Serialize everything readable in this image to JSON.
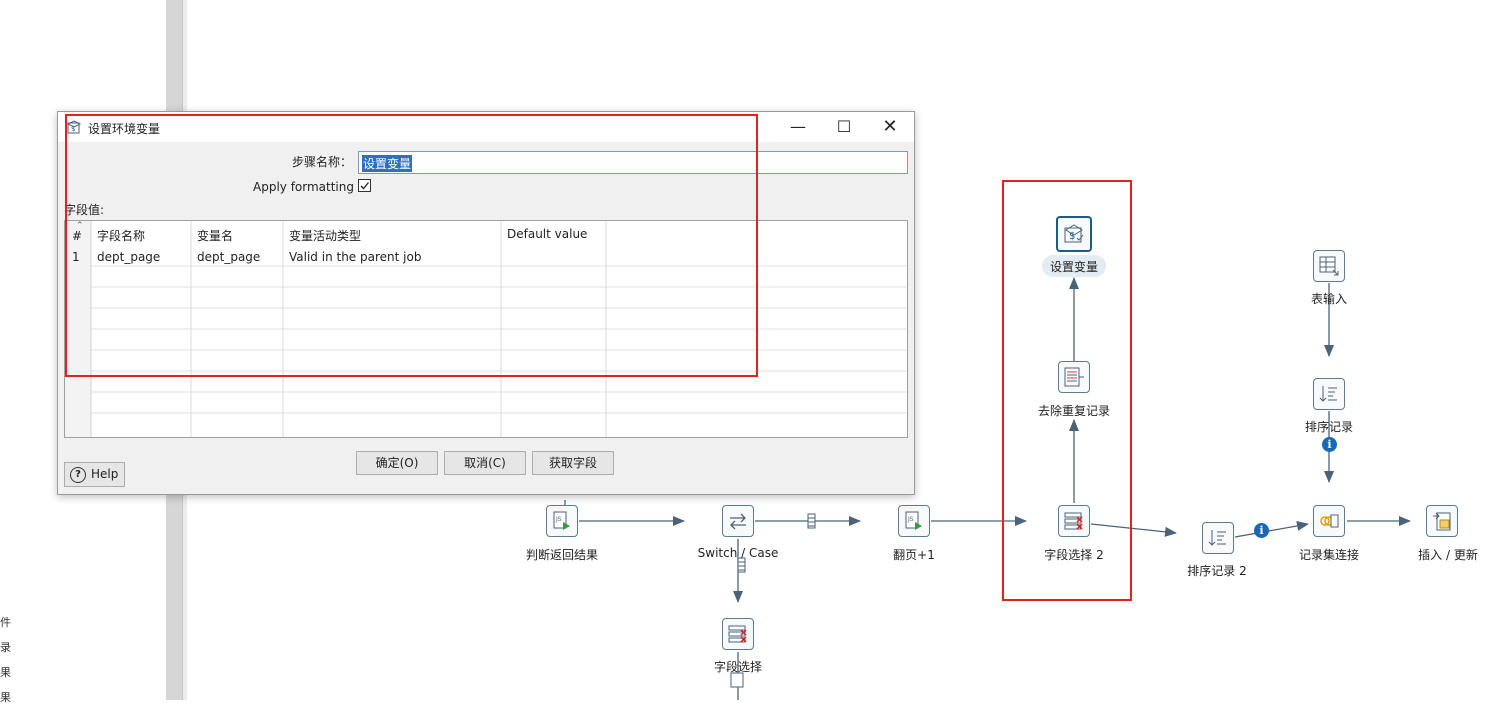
{
  "left_panel": {
    "items": [
      "件",
      "录",
      "果",
      "果"
    ]
  },
  "dialog": {
    "title": "设置环境变量",
    "step_name_label": "步骤名称：",
    "step_name_value": "设置变量",
    "apply_formatting_label": "Apply formatting",
    "apply_formatting_checked": true,
    "fields_label": "字段值:",
    "columns": [
      "#",
      "字段名称",
      "变量名",
      "变量活动类型",
      "Default value"
    ],
    "rows": [
      {
        "num": "1",
        "field": "dept_page",
        "variable": "dept_page",
        "type": "Valid in the parent job",
        "default": ""
      }
    ],
    "buttons": {
      "ok": "确定(O)",
      "cancel": "取消(C)",
      "get_fields": "获取字段"
    },
    "help": "Help"
  },
  "canvas": {
    "nodes": {
      "judge": "判断返回结果",
      "switch": "Switch / Case",
      "page_inc": "翻页+1",
      "field_select_2": "字段选择 2",
      "dedupe": "去除重复记录",
      "set_var": "设置变量",
      "sort_2": "排序记录 2",
      "table_input": "表输入",
      "sort": "排序记录",
      "merge_join": "记录集连接",
      "insert_update": "插入 / 更新",
      "field_select": "字段选择"
    }
  },
  "colors": {
    "highlight_red": "#e0231c",
    "node_border": "#5a7b93",
    "hop": "#4a6378",
    "info_blue": "#1669b7"
  }
}
